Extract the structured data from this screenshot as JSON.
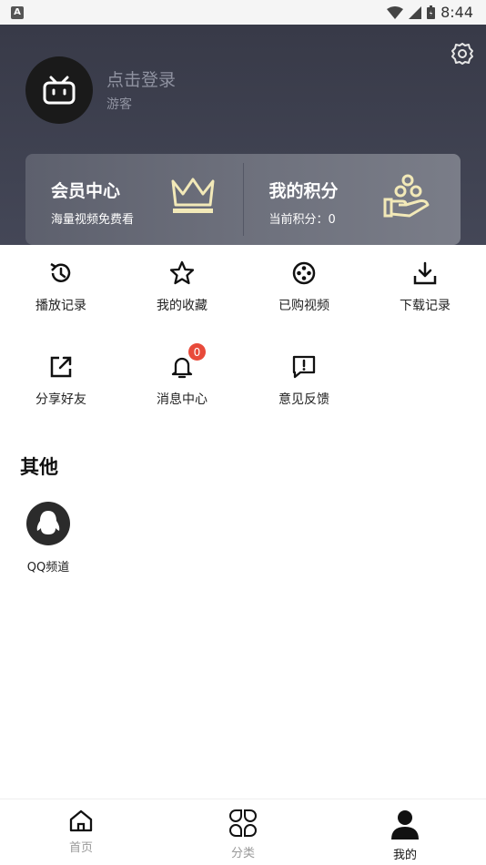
{
  "status_bar": {
    "time": "8:44",
    "notification_glyph": "A"
  },
  "profile": {
    "login_prompt": "点击登录",
    "user_type": "游客"
  },
  "cards": [
    {
      "title": "会员中心",
      "subtitle": "海量视频免费看",
      "icon": "crown-icon"
    },
    {
      "title": "我的积分",
      "subtitle": "当前积分：0",
      "icon": "points-hand-icon"
    }
  ],
  "features": [
    {
      "label": "播放记录",
      "icon": "history-icon"
    },
    {
      "label": "我的收藏",
      "icon": "star-icon"
    },
    {
      "label": "已购视频",
      "icon": "film-reel-icon"
    },
    {
      "label": "下载记录",
      "icon": "download-icon"
    },
    {
      "label": "分享好友",
      "icon": "share-icon"
    },
    {
      "label": "消息中心",
      "icon": "bell-icon",
      "badge": "0"
    },
    {
      "label": "意见反馈",
      "icon": "feedback-icon"
    }
  ],
  "other": {
    "title": "其他",
    "items": [
      {
        "label": "QQ频道",
        "icon": "qq-icon"
      }
    ]
  },
  "tabbar": [
    {
      "label": "首页",
      "icon": "home-icon",
      "active": false
    },
    {
      "label": "分类",
      "icon": "category-icon",
      "active": false
    },
    {
      "label": "我的",
      "icon": "user-icon",
      "active": true
    }
  ],
  "colors": {
    "header_bg": "#3c3e4c",
    "accent_gold": "#f2e9b8",
    "badge_red": "#e84a3a"
  }
}
